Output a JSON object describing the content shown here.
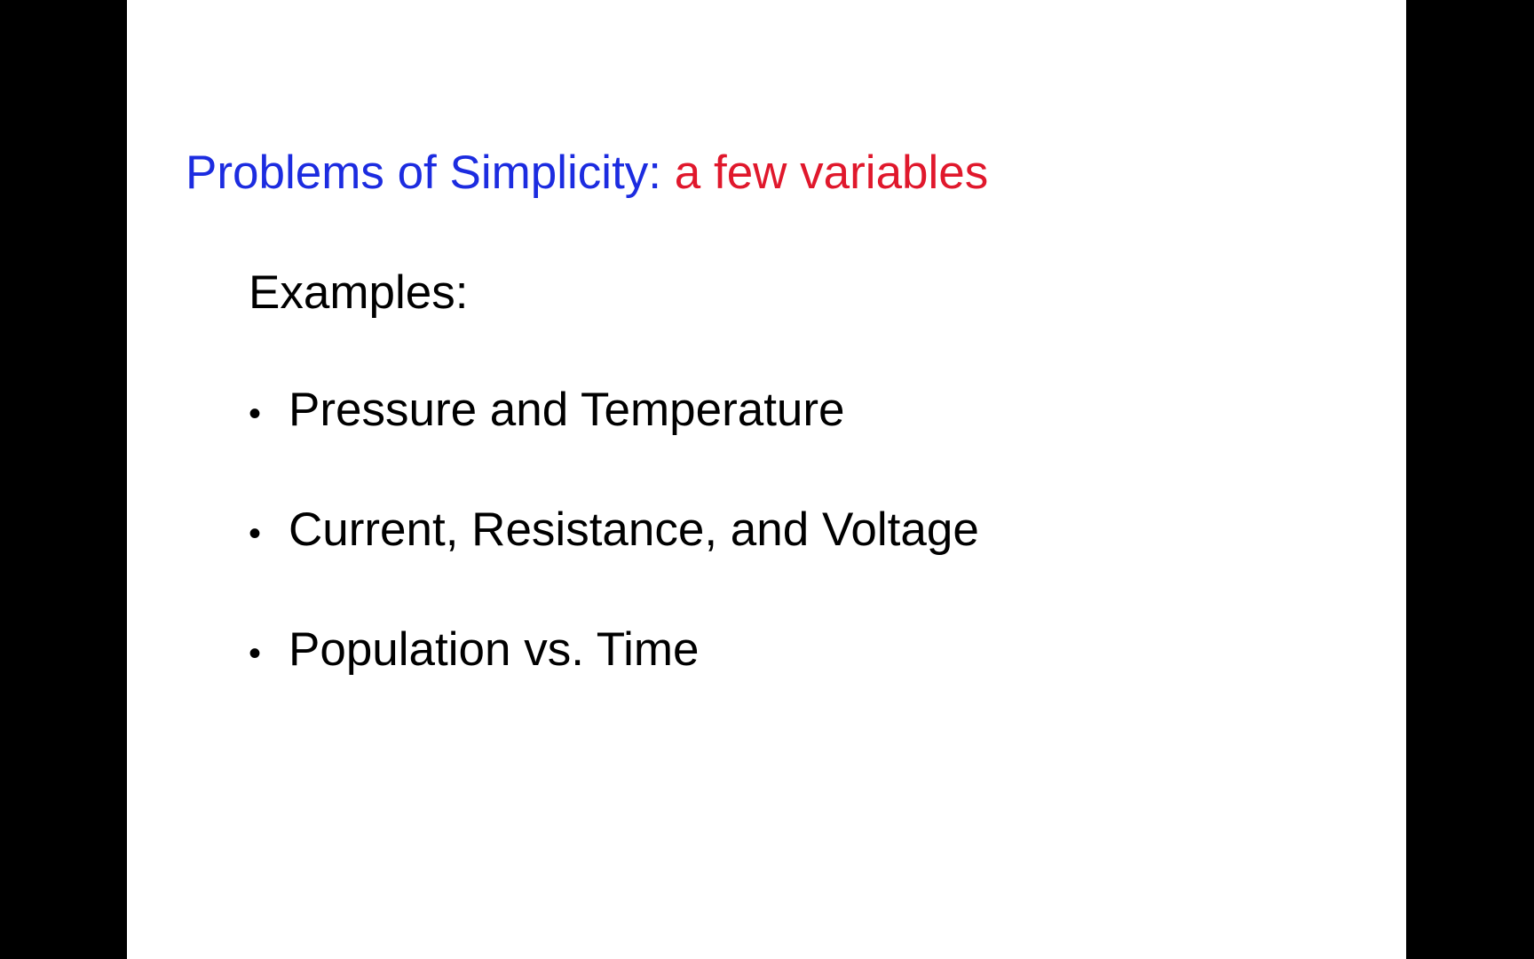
{
  "slide": {
    "title": {
      "part1": "Problems of Simplicity: ",
      "part2": "a few variables",
      "part1_color": "#1c2ce0",
      "part2_color": "#e0182c"
    },
    "heading": "Examples:",
    "bullet_glyph": "•",
    "items": [
      {
        "label": "Pressure and Temperature"
      },
      {
        "label": "Current, Resistance, and Voltage"
      },
      {
        "label": "Population vs. Time"
      }
    ]
  }
}
